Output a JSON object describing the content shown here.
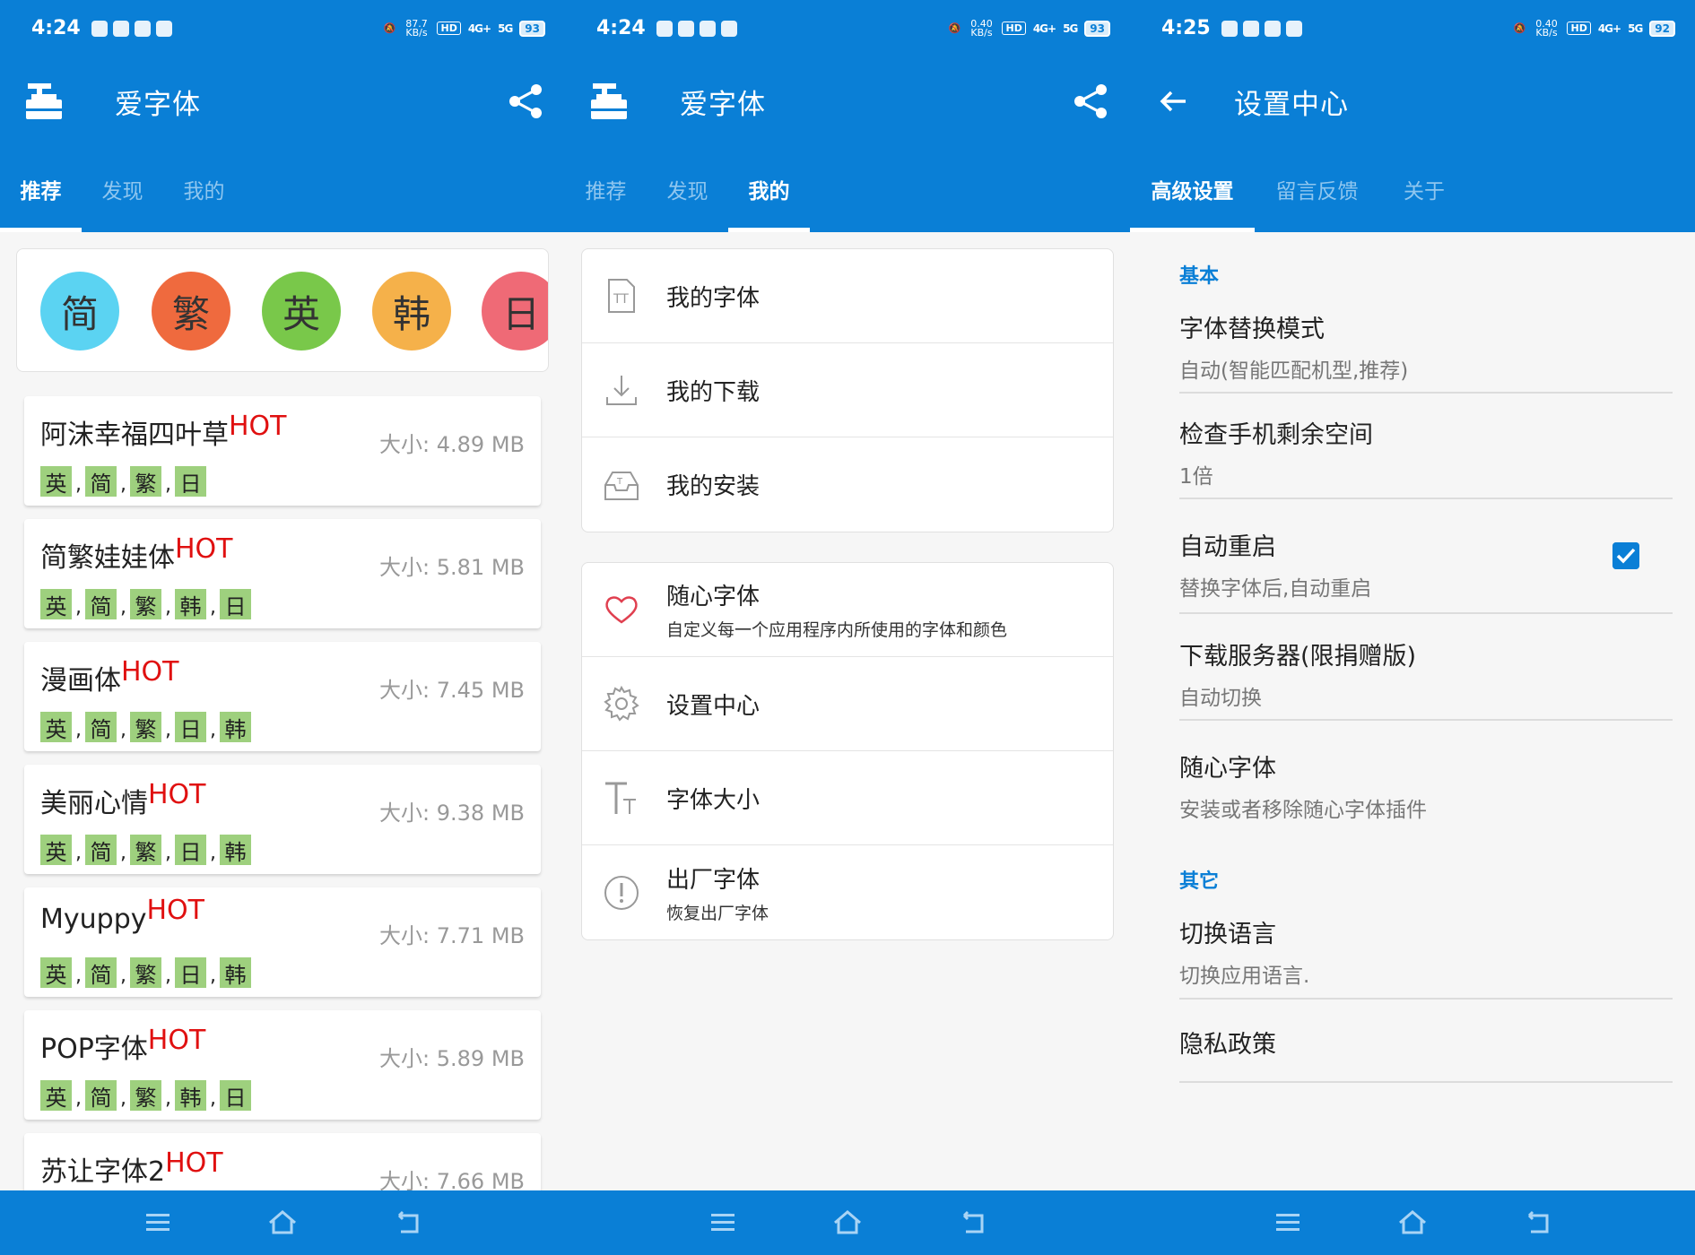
{
  "colors": {
    "primary": "#0a7fd6",
    "hot": "#e01010",
    "tag_bg": "#9ed07e"
  },
  "status_left": {
    "time": "4:24"
  },
  "status_mid": {
    "time": "4:24"
  },
  "status_right": {
    "time": "4:25"
  },
  "status_speed_left": "87.7 KB/s",
  "status_speed_mid": "0.40 KB/s",
  "status_speed_right": "0.40 KB/s",
  "battery_left": "93",
  "battery_mid": "93",
  "battery_right": "92",
  "status_pills": {
    "hd": "HD",
    "g4": "4G+",
    "g5": "5G"
  },
  "panel1": {
    "title": "爱字体",
    "tabs": [
      "推荐",
      "发现",
      "我的"
    ],
    "chips": [
      {
        "label": "简",
        "color": "#5bd3f2"
      },
      {
        "label": "繁",
        "color": "#ef6a3e"
      },
      {
        "label": "英",
        "color": "#79c84a"
      },
      {
        "label": "韩",
        "color": "#f5b14a"
      },
      {
        "label": "日",
        "color": "#ef6a76"
      }
    ],
    "hot_label": "HOT",
    "fonts": [
      {
        "name": "阿沫幸福四叶草",
        "size": "大小: 4.89 MB",
        "tags": [
          "英",
          "简",
          "繁",
          "日"
        ]
      },
      {
        "name": "简繁娃娃体",
        "size": "大小: 5.81 MB",
        "tags": [
          "英",
          "简",
          "繁",
          "韩",
          "日"
        ]
      },
      {
        "name": "漫画体",
        "size": "大小: 7.45 MB",
        "tags": [
          "英",
          "简",
          "繁",
          "日",
          "韩"
        ]
      },
      {
        "name": "美丽心情",
        "size": "大小: 9.38 MB",
        "tags": [
          "英",
          "简",
          "繁",
          "日",
          "韩"
        ]
      },
      {
        "name": "Myuppy",
        "size": "大小: 7.71 MB",
        "tags": [
          "英",
          "简",
          "繁",
          "日",
          "韩"
        ]
      },
      {
        "name": "POP字体",
        "size": "大小: 5.89 MB",
        "tags": [
          "英",
          "简",
          "繁",
          "韩",
          "日"
        ]
      },
      {
        "name": "苏让字体2",
        "size": "大小: 7.66 MB",
        "tags": []
      }
    ]
  },
  "panel2": {
    "title": "爱字体",
    "tabs": [
      "推荐",
      "发现",
      "我的"
    ],
    "group1": [
      {
        "title": "我的字体",
        "icon": "font-file-icon"
      },
      {
        "title": "我的下载",
        "icon": "download-icon"
      },
      {
        "title": "我的安装",
        "icon": "install-tray-icon"
      }
    ],
    "group2": [
      {
        "title": "随心字体",
        "sub": "自定义每一个应用程序内所使用的字体和颜色",
        "icon": "heart-icon"
      },
      {
        "title": "设置中心",
        "icon": "gear-icon"
      },
      {
        "title": "字体大小",
        "icon": "text-size-icon"
      },
      {
        "title": "出厂字体",
        "sub": "恢复出厂字体",
        "icon": "alert-icon"
      }
    ]
  },
  "panel3": {
    "title": "设置中心",
    "tabs": [
      "高级设置",
      "留言反馈",
      "关于"
    ],
    "section_basic": "基本",
    "section_other": "其它",
    "prefs": [
      {
        "title": "字体替换模式",
        "sum": "自动(智能匹配机型,推荐)"
      },
      {
        "title": "检查手机剩余空间",
        "sum": "1倍"
      },
      {
        "title": "自动重启",
        "sum": "替换字体后,自动重启"
      },
      {
        "title": "下载服务器(限捐赠版)",
        "sum": "自动切换"
      },
      {
        "title": "随心字体",
        "sum": "安装或者移除随心字体插件"
      },
      {
        "title": "切换语言",
        "sum": "切换应用语言."
      },
      {
        "title": "隐私政策",
        "sum": ""
      }
    ]
  }
}
